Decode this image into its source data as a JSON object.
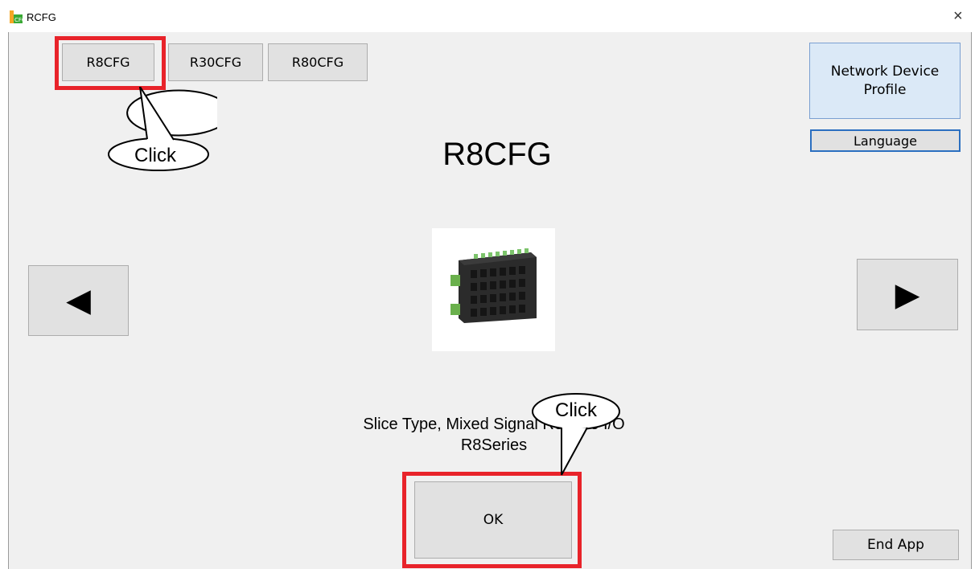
{
  "window": {
    "title": "RCFG",
    "close_glyph": "×"
  },
  "tabs": [
    {
      "label": "R8CFG"
    },
    {
      "label": "R30CFG"
    },
    {
      "label": "R80CFG"
    }
  ],
  "side_buttons": {
    "network_device_profile": "Network Device\nProfile",
    "language": "Language",
    "end_app": "End App"
  },
  "product": {
    "title": "R8CFG",
    "description_line1": "Slice Type, Mixed Signal Remote I/O",
    "description_line2": "R8Series"
  },
  "navigation": {
    "prev_glyph": "◀",
    "next_glyph": "▶"
  },
  "ok_label": "OK",
  "annotations": {
    "callout_tab": "Click",
    "callout_ok": "Click"
  },
  "colors": {
    "highlight": "#e8232a",
    "client_bg": "#f0f0f0",
    "ndp_bg": "#dbe9f7",
    "ndp_border": "#7a9fd1"
  }
}
